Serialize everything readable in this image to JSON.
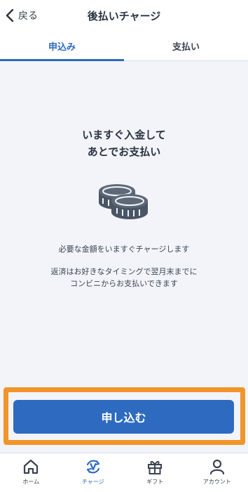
{
  "header": {
    "back_label": "戻る",
    "title": "後払いチャージ"
  },
  "tabs": [
    {
      "label": "申込み",
      "active": true
    },
    {
      "label": "支払い",
      "active": false
    }
  ],
  "main": {
    "headline_line1": "いますぐ入金して",
    "headline_line2": "あとでお支払い",
    "icon": "coins-icon",
    "description_line1": "必要な金額をいますぐチャージします",
    "description_line2": "返済はお好きなタイミングで翌月末までに",
    "description_line3": "コンビニからお支払いできます"
  },
  "cta": {
    "label": "申し込む"
  },
  "tabbar": [
    {
      "label": "ホーム",
      "icon": "home-icon",
      "active": false
    },
    {
      "label": "チャージ",
      "icon": "charge-icon",
      "active": true
    },
    {
      "label": "ギフト",
      "icon": "gift-icon",
      "active": false
    },
    {
      "label": "アカウント",
      "icon": "account-icon",
      "active": false
    }
  ],
  "colors": {
    "accent": "#2e6bc0",
    "highlight": "#f0952a",
    "background": "#f2f4f9",
    "text": "#3a4250"
  }
}
